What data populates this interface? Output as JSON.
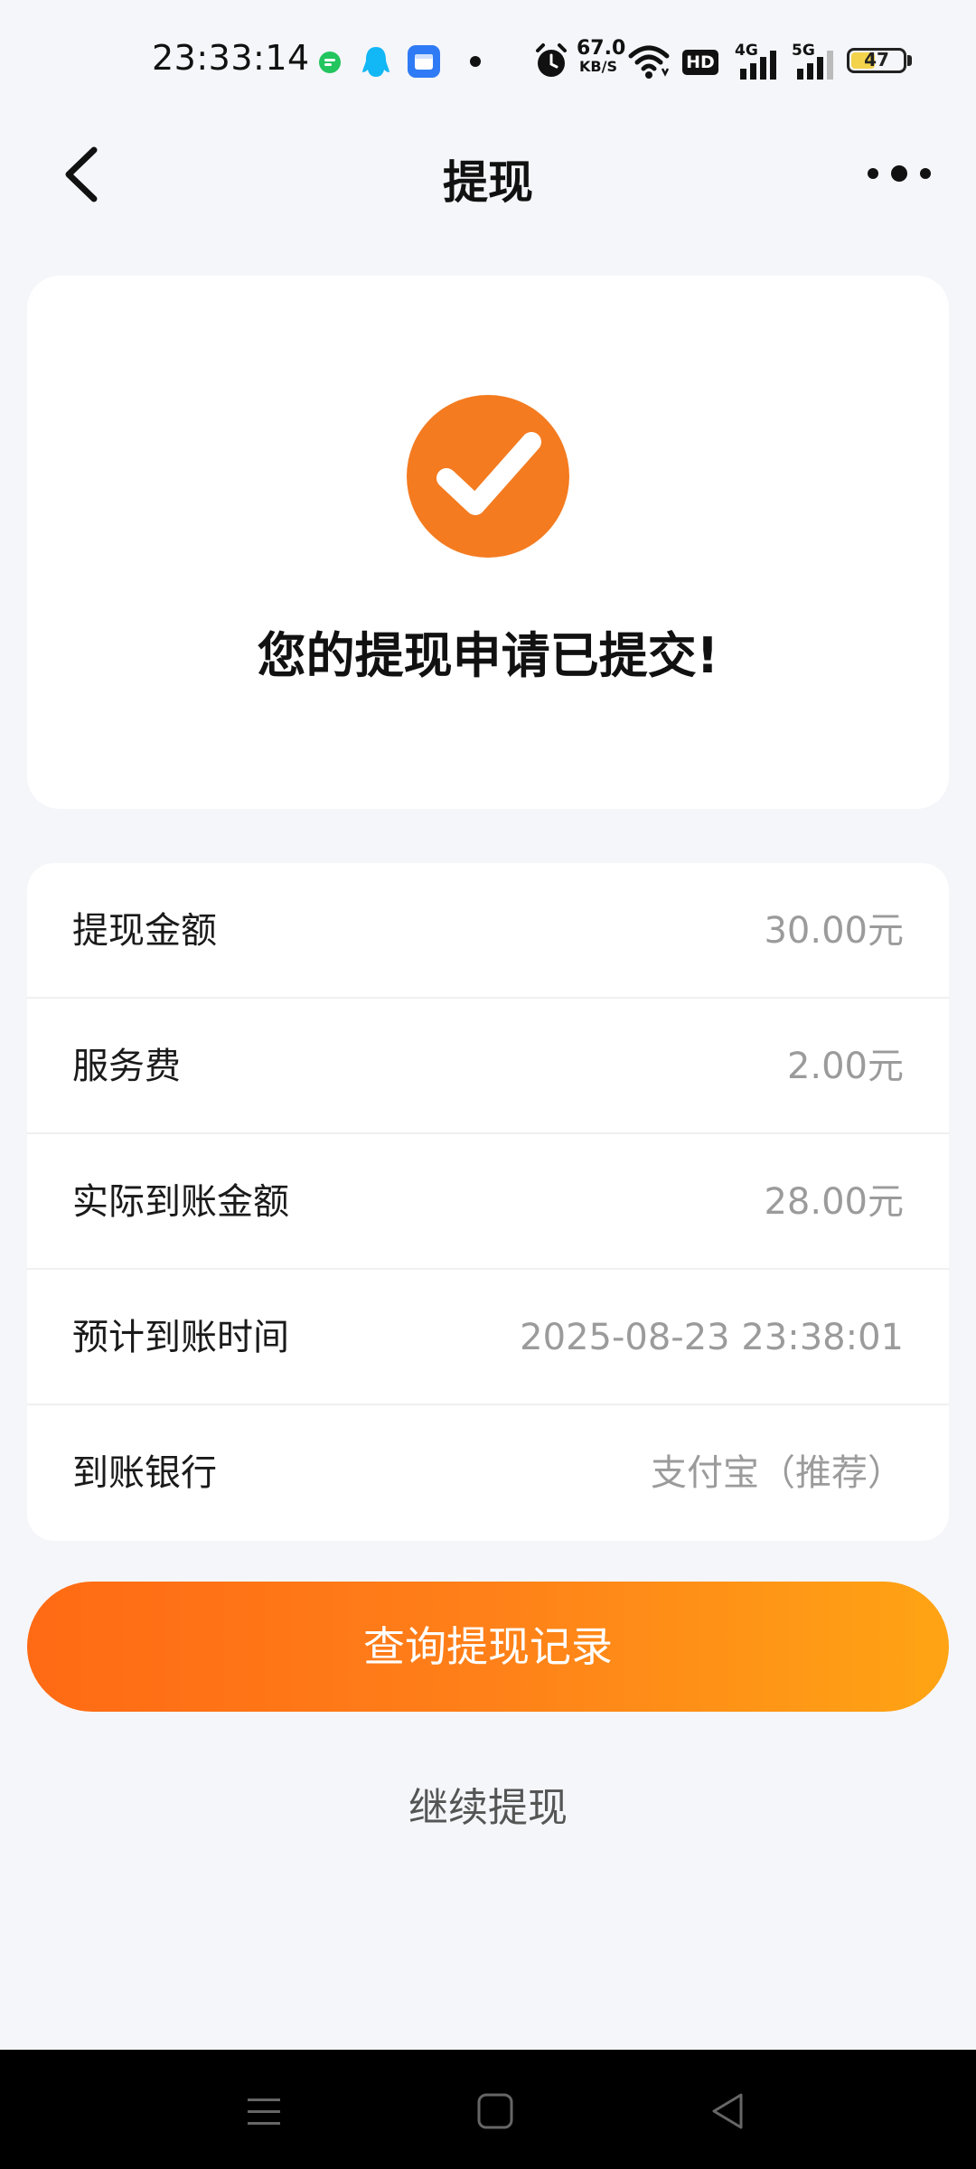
{
  "status_bar": {
    "time": "23:33:14",
    "net_speed_value": "67.0",
    "net_speed_unit": "KB/S",
    "network_4g": "4G",
    "network_5g": "5G",
    "hd_label": "HD",
    "battery_level": "47",
    "battery_fraction": 0.47,
    "app_icons": [
      "green-chat-icon",
      "qq-penguin-icon",
      "blue-app-icon"
    ],
    "system_icons": [
      "alarm-icon",
      "wifi-icon",
      "hd-icon",
      "signal-4g-icon",
      "signal-5g-icon",
      "battery-icon"
    ]
  },
  "nav": {
    "title": "提现",
    "back_icon": "chevron-left-icon",
    "more_icon": "more-dots-icon"
  },
  "success": {
    "icon": "check-circle-icon",
    "message": "您的提现申请已提交!",
    "icon_color": "#f47b20"
  },
  "details": [
    {
      "label": "提现金额",
      "value": "30.00元"
    },
    {
      "label": "服务费",
      "value": "2.00元"
    },
    {
      "label": "实际到账金额",
      "value": "28.00元"
    },
    {
      "label": "预计到账时间",
      "value": "2025-08-23 23:38:01"
    },
    {
      "label": "到账银行",
      "value": "支付宝（推荐）"
    }
  ],
  "actions": {
    "primary_label": "查询提现记录",
    "secondary_label": "继续提现",
    "gradient_start": "#ff6a14",
    "gradient_end": "#ffa414"
  },
  "system_nav": {
    "icons": [
      "menu-icon",
      "home-square-icon",
      "back-triangle-icon"
    ]
  }
}
